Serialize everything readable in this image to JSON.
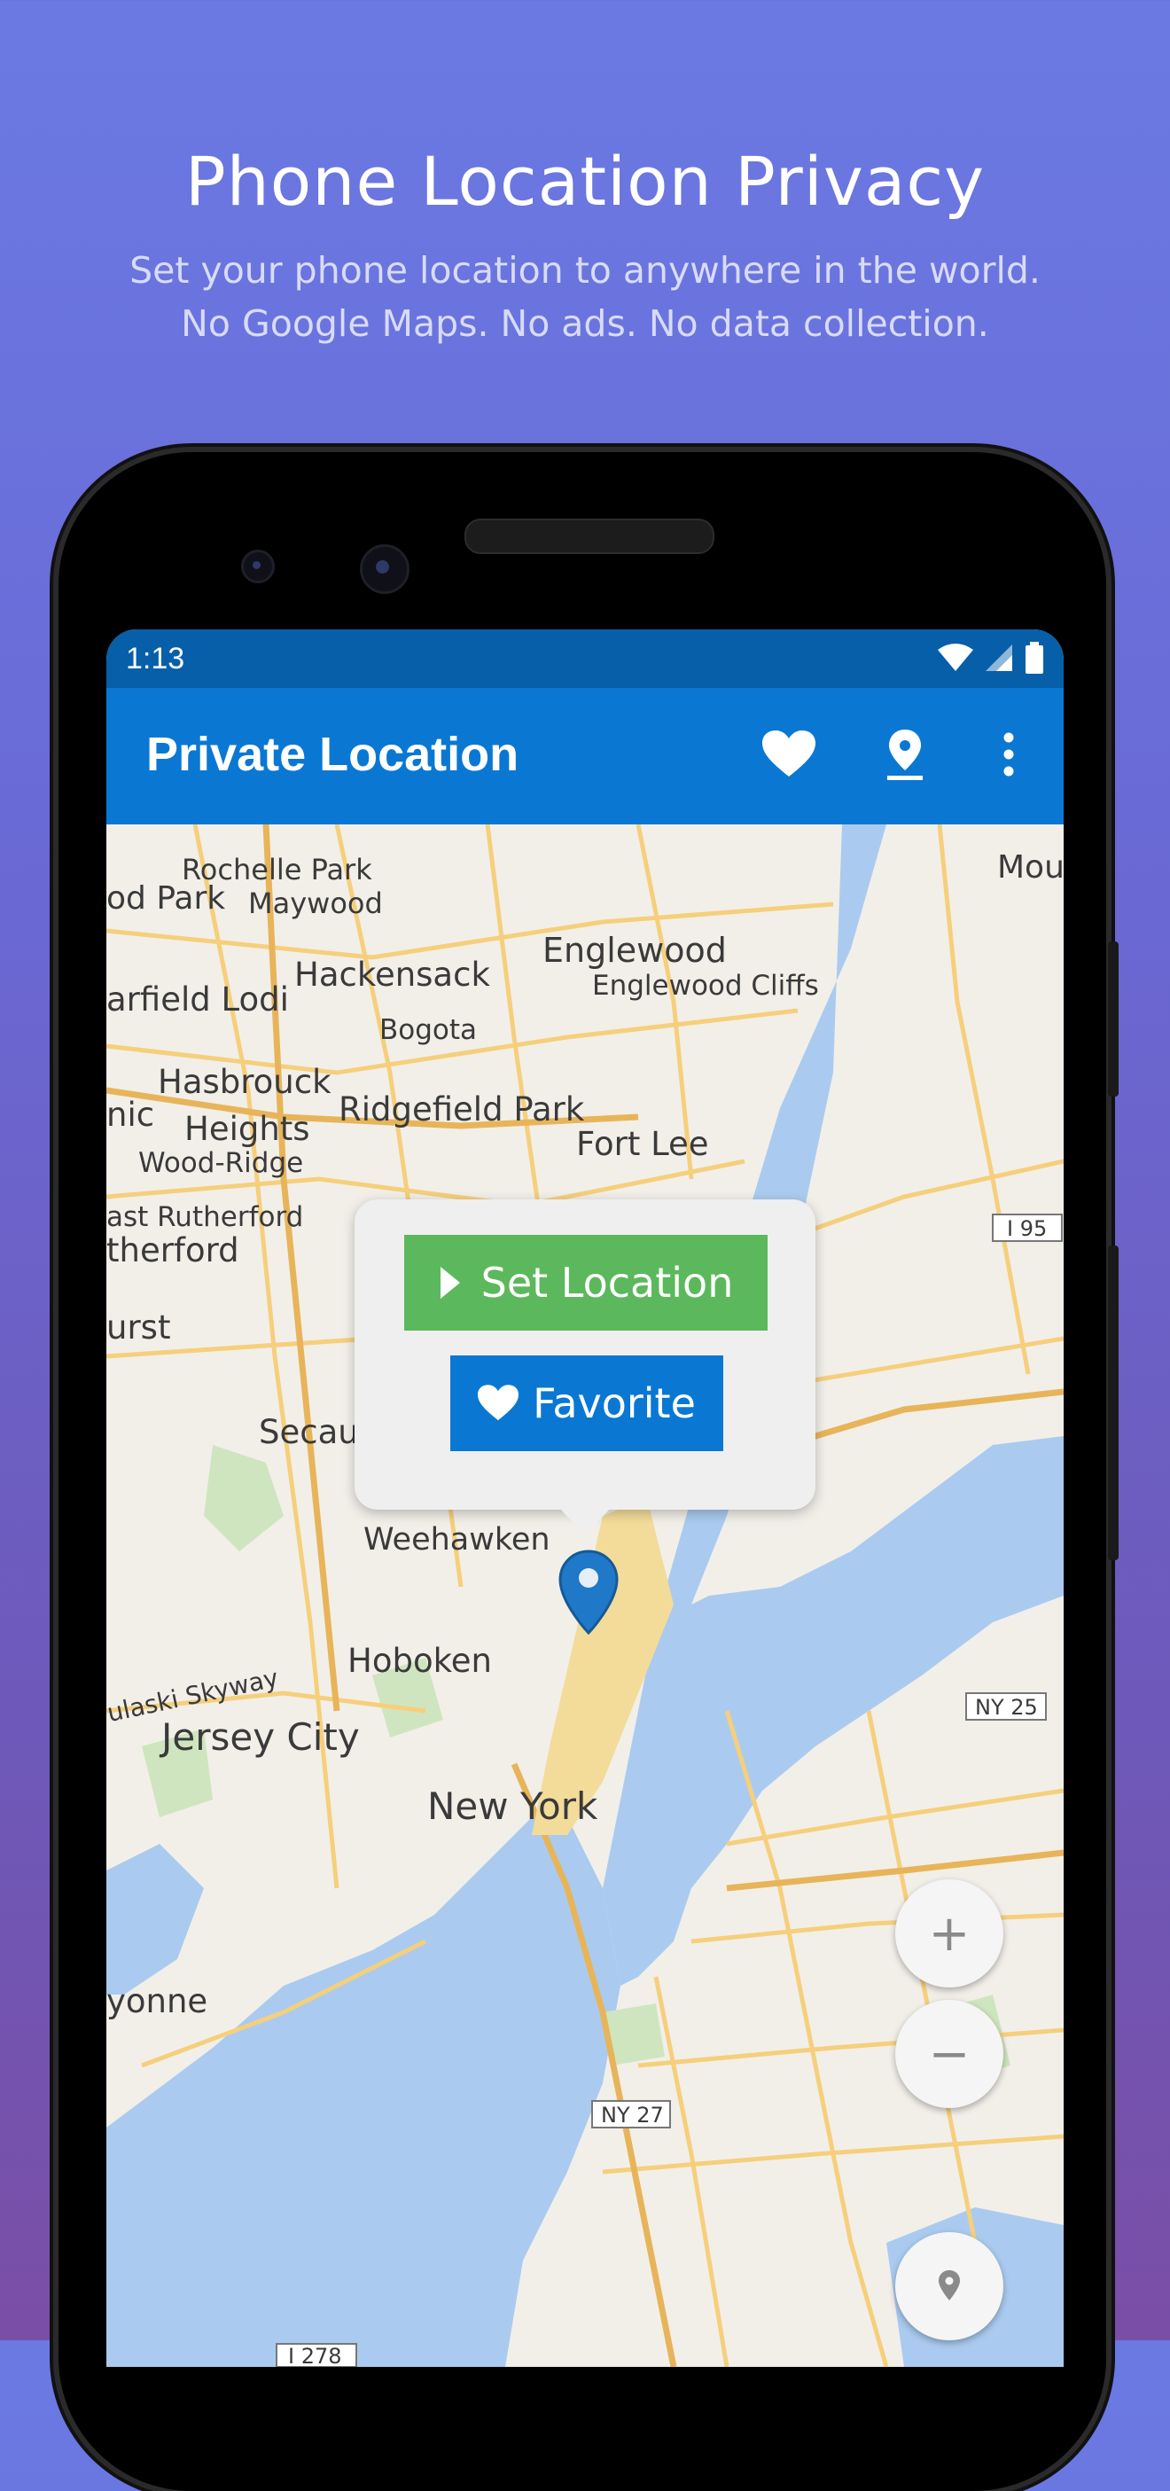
{
  "promo": {
    "title": "Phone Location Privacy",
    "subtitle_line1": "Set your phone location to anywhere in the world.",
    "subtitle_line2": "No Google Maps. No ads. No data collection."
  },
  "status_bar": {
    "time": "1:13",
    "icons": [
      "wifi-icon",
      "cell-signal-icon",
      "battery-icon"
    ]
  },
  "app_bar": {
    "title": "Private Location",
    "actions": [
      "heart-icon",
      "pin-icon",
      "more-vert-icon"
    ]
  },
  "popup": {
    "set_location_label": "Set Location",
    "favorite_label": "Favorite"
  },
  "map_controls": {
    "zoom_in": "+",
    "zoom_out": "−"
  },
  "map_labels": {
    "rochelle_park": "Rochelle Park",
    "od_park": "od Park",
    "maywood": "Maywood",
    "mou": "Mou",
    "englewood": "Englewood",
    "englewood_cliffs": "Englewood Cliffs",
    "hackensack": "Hackensack",
    "arfield_lodi": "arfield Lodi",
    "bogota": "Bogota",
    "hasbrouck": "Hasbrouck",
    "heights": "Heights",
    "nic": "nic",
    "ridgefield_park": "Ridgefield Park",
    "fort_lee": "Fort Lee",
    "wood_ridge": "Wood-Ridge",
    "i95": "I 95",
    "east_rutherford": "ast Rutherford",
    "rutherford": "therford",
    "hurst": "urst",
    "secau": "Secau",
    "weehawken": "Weehawken",
    "hoboken": "Hoboken",
    "pulaski_skyway": "ulaski Skyway",
    "ny25": "NY 25",
    "jersey_city": "Jersey City",
    "new_york": "New York",
    "yonne": "yonne",
    "ny27": "NY 27",
    "i278": "I 278"
  },
  "colors": {
    "app_bar": "#0a78d3",
    "status_bar": "#065fa8",
    "set_location_button": "#5cb85c",
    "favorite_button": "#0a78d3",
    "water": "#aacbef",
    "land": "#f2efe9",
    "road": "#f6cf7c"
  }
}
